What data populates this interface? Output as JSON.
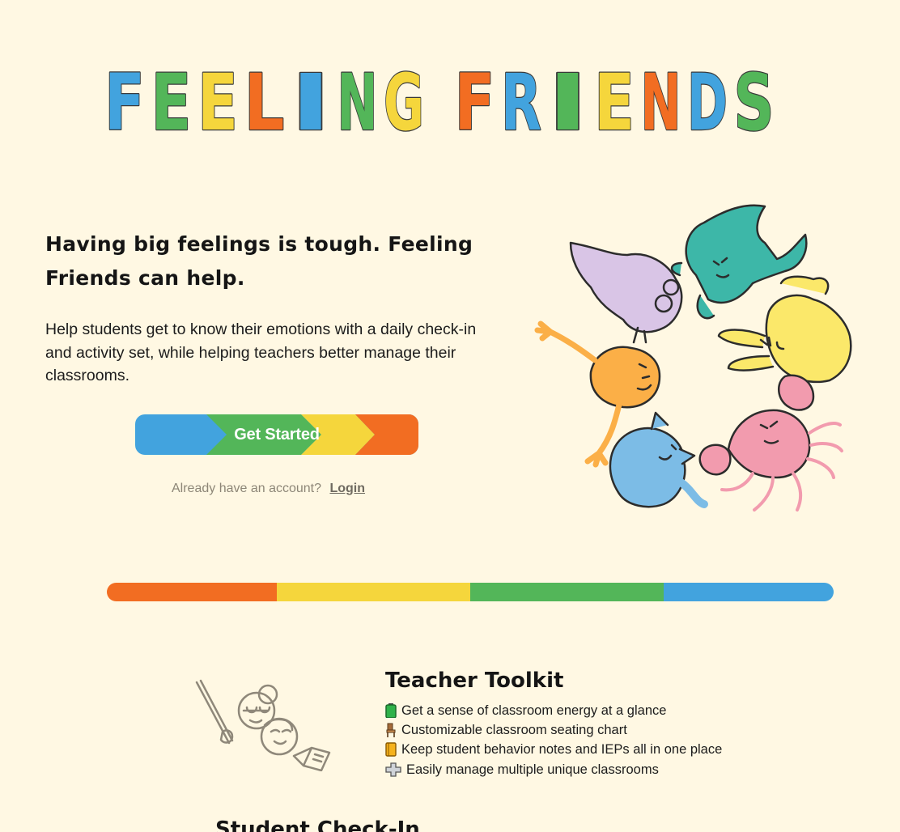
{
  "logo": {
    "text": "FEELING FRIENDS",
    "letters": [
      {
        "ch": "F",
        "color": "#42A3DE"
      },
      {
        "ch": "E",
        "color": "#53B659"
      },
      {
        "ch": "E",
        "color": "#F5D63C"
      },
      {
        "ch": "L",
        "color": "#F26D22"
      },
      {
        "ch": "I",
        "color": "#42A3DE"
      },
      {
        "ch": "N",
        "color": "#53B659"
      },
      {
        "ch": "G",
        "color": "#F5D63C"
      },
      {
        "ch": " ",
        "color": ""
      },
      {
        "ch": "F",
        "color": "#F26D22"
      },
      {
        "ch": "R",
        "color": "#42A3DE"
      },
      {
        "ch": "I",
        "color": "#53B659"
      },
      {
        "ch": "E",
        "color": "#F5D63C"
      },
      {
        "ch": "N",
        "color": "#F26D22"
      },
      {
        "ch": "D",
        "color": "#42A3DE"
      },
      {
        "ch": "S",
        "color": "#53B659"
      }
    ]
  },
  "hero": {
    "heading": "Having big feelings is tough. Feeling Friends can help.",
    "body": "Help students get to know their emotions with a daily check-in and activity set, while helping teachers better manage their classrooms."
  },
  "cta": {
    "label": "Get Started"
  },
  "login": {
    "prompt": "Already have an account?",
    "link": "Login"
  },
  "colors": {
    "blue": "#42A3DE",
    "green": "#53B659",
    "yellow": "#F5D63C",
    "orange": "#F26D22",
    "background": "#FFF8E3"
  },
  "divider": {
    "segments": [
      "#F26D22",
      "#F5D63C",
      "#53B659",
      "#42A3DE"
    ]
  },
  "toolkit": {
    "title": "Teacher Toolkit",
    "features": [
      {
        "icon": "battery-icon",
        "text": "Get a sense of classroom energy at a glance"
      },
      {
        "icon": "chair-icon",
        "text": "Customizable classroom seating chart"
      },
      {
        "icon": "notebook-icon",
        "text": "Keep student behavior notes and IEPs all in one place"
      },
      {
        "icon": "plus-icon",
        "text": "Easily manage multiple unique classrooms"
      }
    ]
  },
  "checkin": {
    "title": "Student Check-In"
  }
}
